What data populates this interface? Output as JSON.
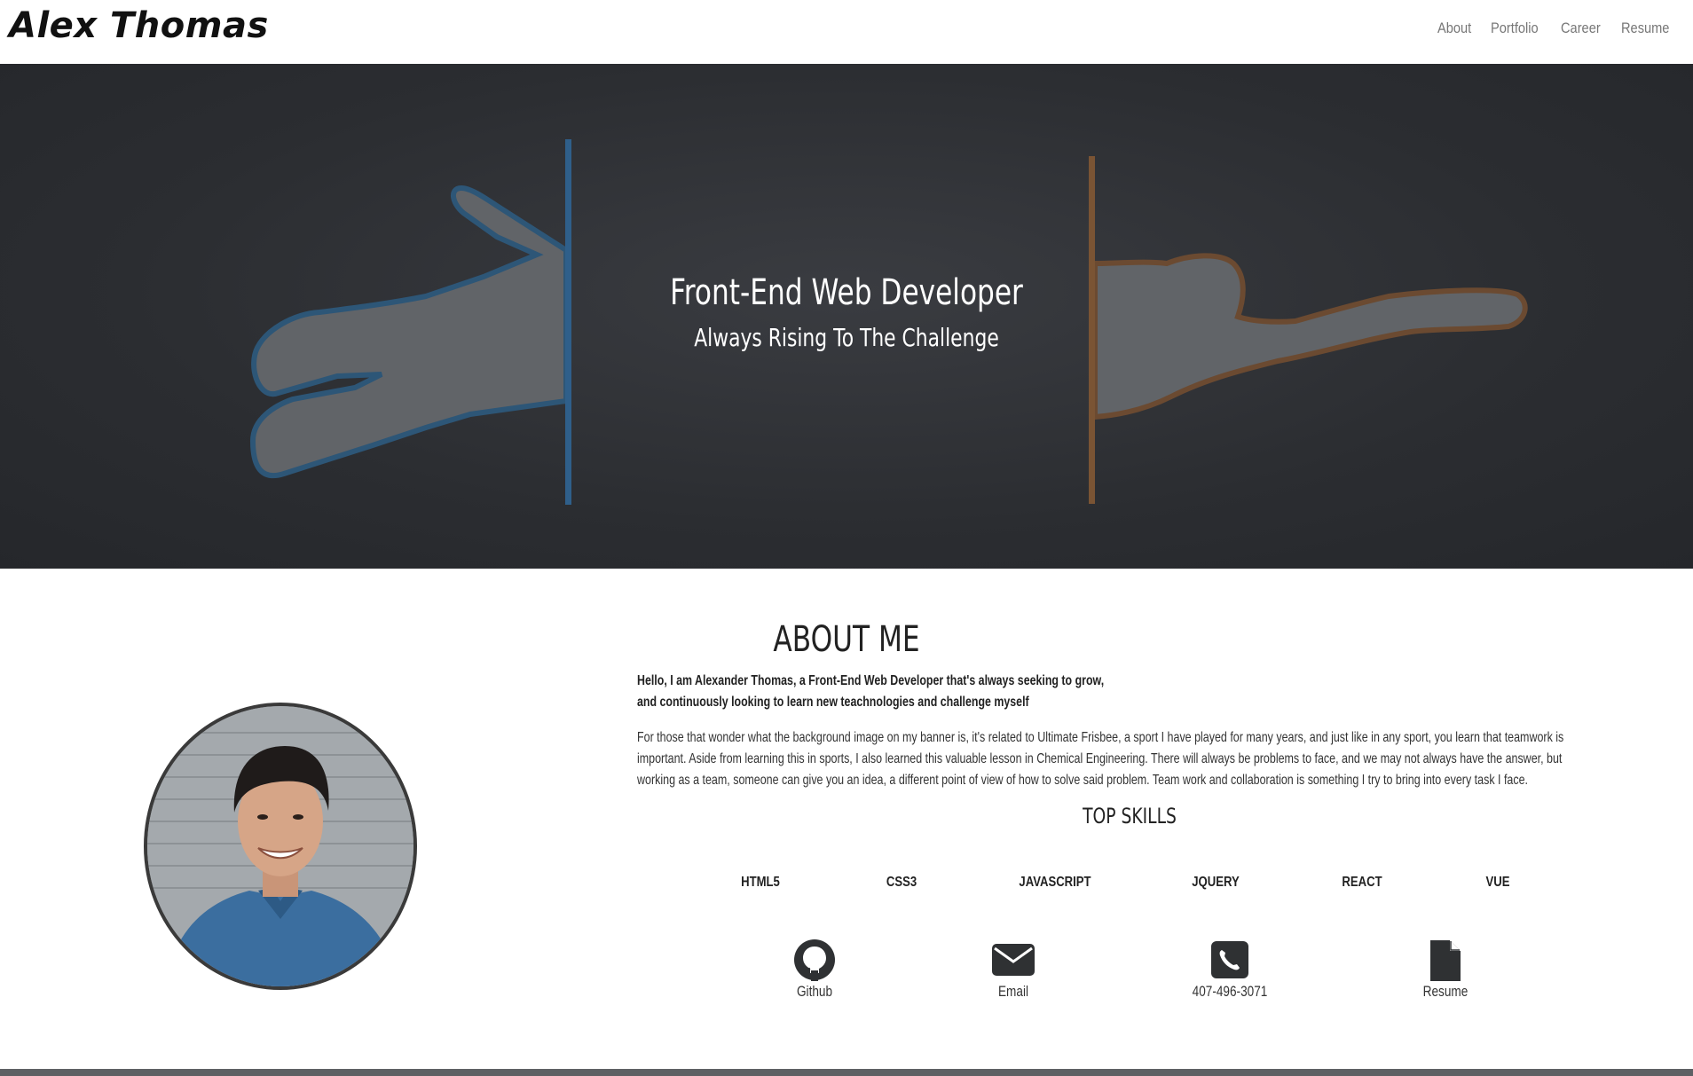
{
  "header": {
    "brand": "Alex Thomas",
    "nav": [
      "About",
      "Portfolio",
      "Career",
      "Resume"
    ]
  },
  "hero": {
    "title": "Front-End Web Developer",
    "subtitle": "Always Rising To The Challenge"
  },
  "about": {
    "title": "ABOUT ME",
    "intro_line1": "Hello, I am Alexander Thomas, a Front-End Web Developer that's always seeking to grow,",
    "intro_line2": "and continuously looking to learn new teachnologies and challenge myself",
    "para_line1": "For those that wonder what the background image on my banner is, it's related to Ultimate Frisbee, a sport I have played for many years, and just like in any sport, you learn that teamwork is",
    "para_line2": "important. Aside from learning this in sports, I also learned this valuable lesson in Chemical Engineering. There will always be problems to face, and we may not always have the answer, but",
    "para_line3": "working as a team, someone can give you an idea, a different point of view of how to solve said problem. Team work and collaboration is something I try to bring into every task I face."
  },
  "skills": {
    "title": "TOP SKILLS",
    "items": [
      "HTML5",
      "CSS3",
      "JAVASCRIPT",
      "JQUERY",
      "REACT",
      "VUE"
    ]
  },
  "contacts": [
    {
      "label": "Github",
      "icon": "github-icon"
    },
    {
      "label": "Email",
      "icon": "envelope-icon"
    },
    {
      "label": "407-496-3071",
      "icon": "phone-icon"
    },
    {
      "label": "Resume",
      "icon": "file-icon"
    }
  ],
  "colors": {
    "hero_bg": "#2b2d31",
    "blue_line": "#2f5f8a",
    "orange_line": "#7a5434",
    "silhouette": "#626569"
  }
}
